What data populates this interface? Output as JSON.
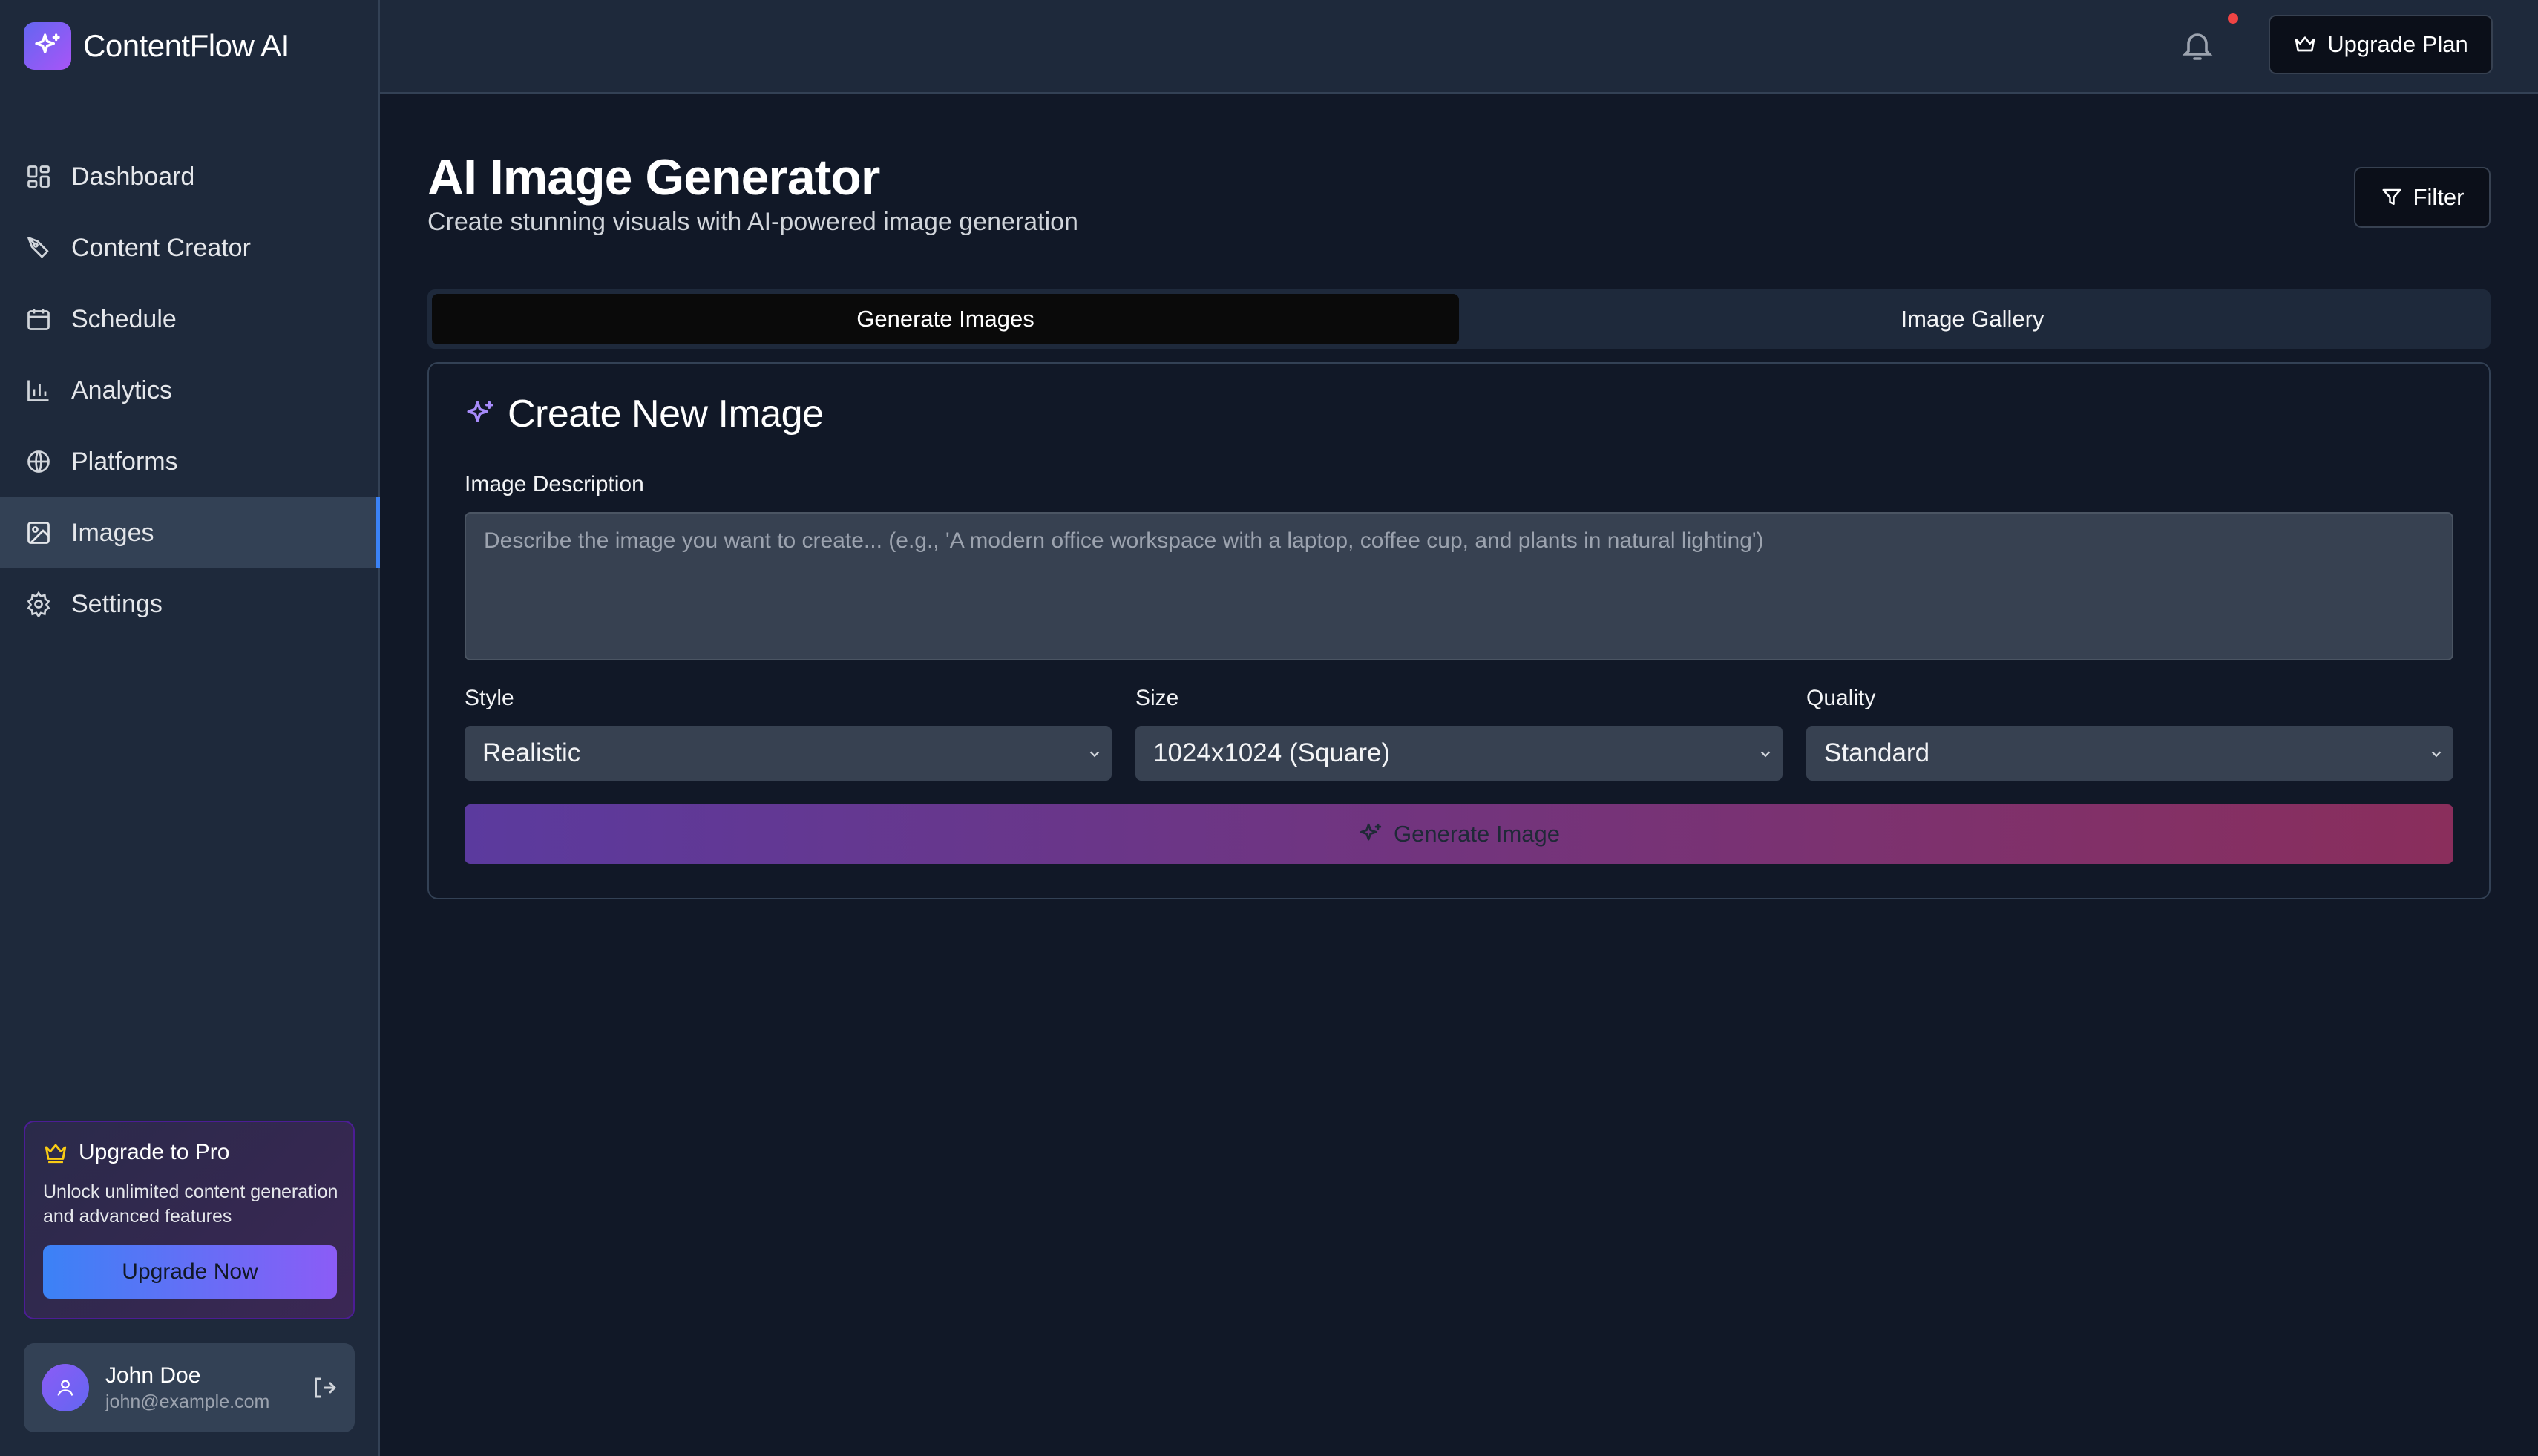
{
  "app": {
    "name": "ContentFlow AI",
    "logo_icon": "sparkles-icon",
    "accent": "#8b5cf6"
  },
  "sidebar": {
    "items": [
      {
        "label": "Dashboard",
        "icon": "dashboard-icon"
      },
      {
        "label": "Content Creator",
        "icon": "pen-icon"
      },
      {
        "label": "Schedule",
        "icon": "calendar-icon"
      },
      {
        "label": "Analytics",
        "icon": "bar-chart-icon"
      },
      {
        "label": "Platforms",
        "icon": "globe-icon"
      },
      {
        "label": "Images",
        "icon": "image-icon",
        "active": true
      },
      {
        "label": "Settings",
        "icon": "gear-icon"
      }
    ],
    "upgrade": {
      "title": "Upgrade to Pro",
      "description": "Unlock unlimited content generation and advanced features",
      "button": "Upgrade Now"
    },
    "user": {
      "name": "John Doe",
      "email": "john@example.com"
    }
  },
  "header": {
    "upgrade_plan": "Upgrade Plan",
    "notification_dot_color": "#ef4444"
  },
  "main": {
    "title": "AI Image Generator",
    "subtitle": "Create stunning visuals with AI-powered image generation",
    "filter_label": "Filter",
    "tabs": [
      {
        "label": "Generate Images",
        "active": true
      },
      {
        "label": "Image Gallery",
        "active": false
      }
    ],
    "form": {
      "title": "Create New Image",
      "description_label": "Image Description",
      "description_placeholder": "Describe the image you want to create... (e.g., 'A modern office workspace with a laptop, coffee cup, and plants in natural lighting')",
      "description_value": "",
      "style": {
        "label": "Style",
        "value": "Realistic"
      },
      "size": {
        "label": "Size",
        "value": "1024x1024 (Square)"
      },
      "quality": {
        "label": "Quality",
        "value": "Standard"
      },
      "generate_button": "Generate Image"
    }
  }
}
